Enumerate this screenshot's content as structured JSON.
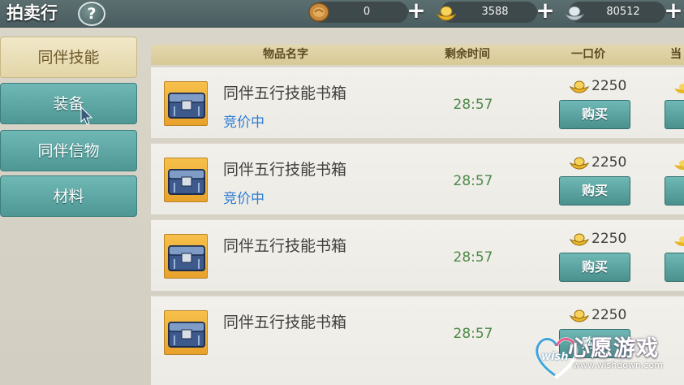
{
  "header": {
    "title": "拍卖行",
    "help_label": "?",
    "currencies": [
      {
        "icon": "copper-coin-icon",
        "value": "0"
      },
      {
        "icon": "gold-ingot-icon",
        "value": "3588"
      },
      {
        "icon": "silver-ingot-icon",
        "value": "80512"
      }
    ],
    "plus_label": "+"
  },
  "sidebar": {
    "items": [
      {
        "label": "同伴技能",
        "active": true
      },
      {
        "label": "装备",
        "active": false
      },
      {
        "label": "同伴信物",
        "active": false
      },
      {
        "label": "材料",
        "active": false
      }
    ]
  },
  "table": {
    "columns": [
      "物品名字",
      "剩余时间",
      "一口价",
      "当前"
    ],
    "rows": [
      {
        "name": "同伴五行技能书箱",
        "status": "竞价中",
        "time": "28:57",
        "price": "2250",
        "buy_label": "购买"
      },
      {
        "name": "同伴五行技能书箱",
        "status": "竞价中",
        "time": "28:57",
        "price": "2250",
        "buy_label": "购买"
      },
      {
        "name": "同伴五行技能书箱",
        "status": "",
        "time": "28:57",
        "price": "2250",
        "buy_label": "购买"
      },
      {
        "name": "同伴五行技能书箱",
        "status": "",
        "time": "28:57",
        "price": "2250",
        "buy_label": "购买"
      }
    ]
  },
  "watermark": {
    "brand": "心愿游戏",
    "badge": "wish",
    "url": "www.wishdown.com"
  },
  "colors": {
    "accent_teal": "#5fa8a5",
    "tab_active": "#e9dfb9",
    "status_blue": "#2f7ed6",
    "time_green": "#4e8a4a"
  }
}
